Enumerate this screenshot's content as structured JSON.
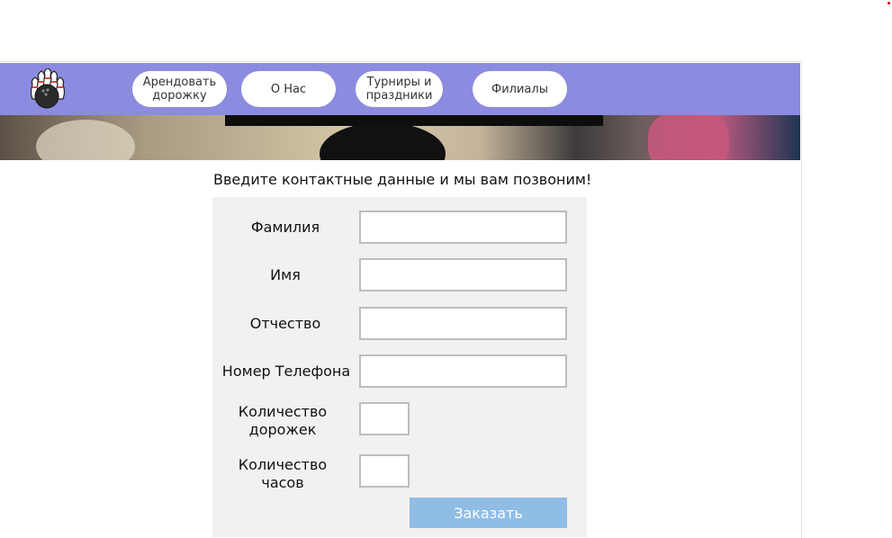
{
  "nav": {
    "items": [
      {
        "label": "Арендовать\nдорожку"
      },
      {
        "label": "О Нас"
      },
      {
        "label": "Турниры и\nпраздники"
      },
      {
        "label": "Филиалы"
      }
    ]
  },
  "form": {
    "heading": "Введите контактные данные и мы вам позвоним!",
    "fields": [
      {
        "label": "Фамилия",
        "value": ""
      },
      {
        "label": "Имя",
        "value": ""
      },
      {
        "label": "Отчество",
        "value": ""
      },
      {
        "label": "Номер Телефона",
        "value": ""
      },
      {
        "label": "Количество\nдорожек",
        "value": ""
      },
      {
        "label": "Количество\nчасов",
        "value": ""
      }
    ],
    "submit_label": "Заказать"
  },
  "colors": {
    "navbar": "#8b8be0",
    "submit": "#8fbde6",
    "panel": "#f1f1f1"
  }
}
